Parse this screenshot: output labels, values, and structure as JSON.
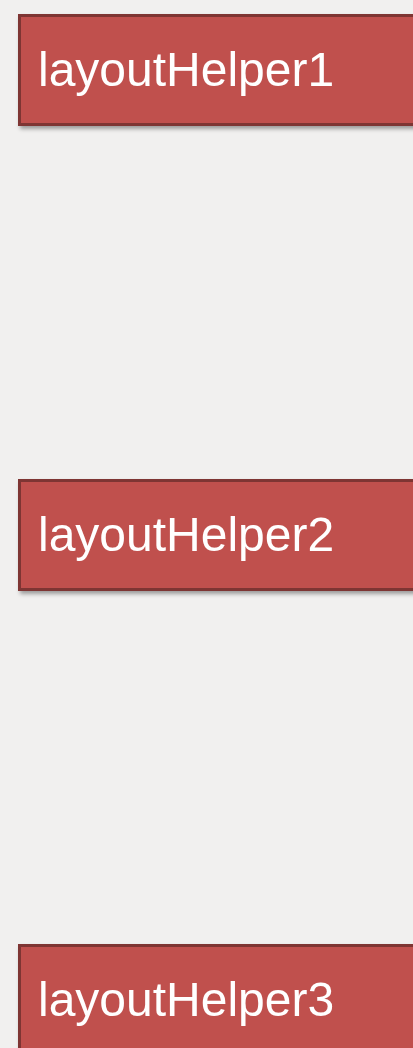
{
  "helpers": [
    {
      "label": "layoutHelper1"
    },
    {
      "label": "layoutHelper2"
    },
    {
      "label": "layoutHelper3"
    }
  ]
}
